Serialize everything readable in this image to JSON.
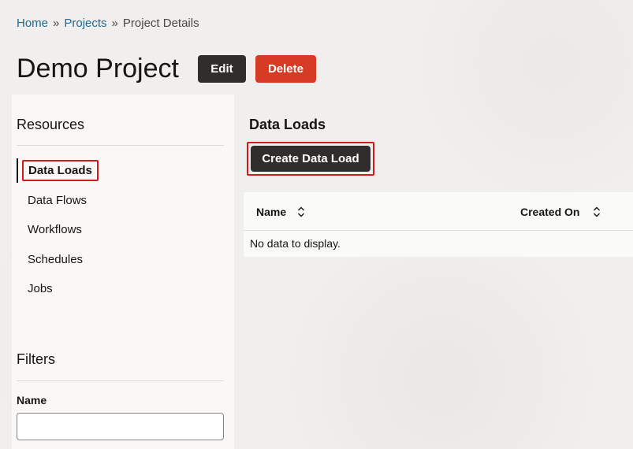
{
  "breadcrumb": {
    "home": "Home",
    "separator": "»",
    "projects": "Projects",
    "current": "Project Details"
  },
  "header": {
    "title": "Demo Project",
    "edit_label": "Edit",
    "delete_label": "Delete"
  },
  "sidebar": {
    "resources_title": "Resources",
    "items": [
      {
        "label": "Data Loads",
        "active": true
      },
      {
        "label": "Data Flows",
        "active": false
      },
      {
        "label": "Workflows",
        "active": false
      },
      {
        "label": "Schedules",
        "active": false
      },
      {
        "label": "Jobs",
        "active": false
      }
    ],
    "filters_title": "Filters",
    "filter_name_label": "Name",
    "filter_name_value": ""
  },
  "main": {
    "title": "Data Loads",
    "create_label": "Create Data Load",
    "table": {
      "columns": [
        "Name",
        "Created On"
      ],
      "empty_text": "No data to display."
    }
  },
  "colors": {
    "link": "#1f6a8f",
    "dark_button": "#312d2a",
    "danger_button": "#d63b25",
    "highlight": "#d21a1a"
  },
  "icons": {
    "sort": "sort-updown-icon"
  }
}
